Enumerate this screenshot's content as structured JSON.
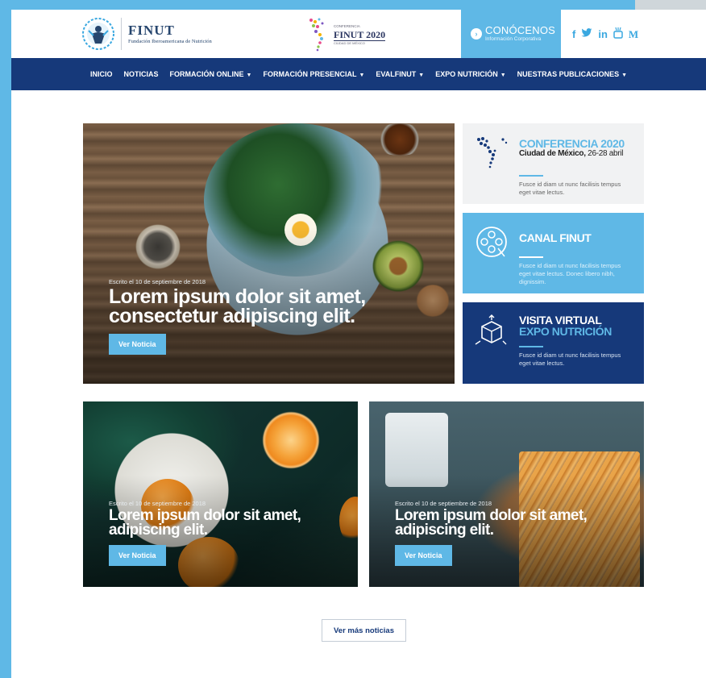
{
  "header": {
    "brand": "FINUT",
    "brand_subtitle": "Fundación Iberoamericana de Nutrición",
    "event_logo": {
      "line1": "CONFERENCIA",
      "name": "FINUT 2020",
      "line2": "CIUDAD DE MÉXICO"
    },
    "cta": {
      "title": "CONÓCENOS",
      "subtitle": "Información Corporativa"
    },
    "social": [
      {
        "icon": "facebook-icon",
        "glyph": "f"
      },
      {
        "icon": "twitter-icon",
        "glyph": "🐦"
      },
      {
        "icon": "linkedin-icon",
        "glyph": "in"
      },
      {
        "icon": "youtube-icon",
        "glyph": "▣"
      },
      {
        "icon": "medium-icon",
        "glyph": "M"
      }
    ]
  },
  "nav": {
    "items": [
      {
        "label": "INICIO",
        "dropdown": false
      },
      {
        "label": "NOTICIAS",
        "dropdown": false
      },
      {
        "label": "FORMACIÓN ONLINE",
        "dropdown": true
      },
      {
        "label": "FORMACIÓN PRESENCIAL",
        "dropdown": true
      },
      {
        "label": "EVALFINUT",
        "dropdown": true
      },
      {
        "label": "EXPO NUTRICIÓN",
        "dropdown": true
      },
      {
        "label": "NUESTRAS PUBLICACIONES",
        "dropdown": true
      }
    ]
  },
  "hero": {
    "meta": "Escrito el 10 de septiembre de 2018",
    "title_line1": "Lorem ipsum dolor sit amet,",
    "title_line2": "consectetur adipiscing elit.",
    "button": "Ver Noticia"
  },
  "panels": {
    "conferencia": {
      "title": "CONFERENCIA 2020",
      "place": "Ciudad de México,",
      "dates": " 26-28 abril",
      "desc": "Fusce id diam ut nunc facilisis tempus eget vitae lectus."
    },
    "canal": {
      "title": "CANAL FINUT",
      "desc": "Fusce id diam ut nunc facilisis tempus eget vitae lectus. Donec libero nibh, dignissim."
    },
    "visita": {
      "title_line1": "VISITA VIRTUAL",
      "title_line2": "EXPO NUTRICIÓN",
      "desc": "Fusce id diam ut nunc facilisis tempus eget vitae lectus."
    }
  },
  "news": [
    {
      "meta": "Escrito el 10 de septiembre de 2018",
      "title_line1": "Lorem ipsum dolor sit amet,",
      "title_line2": "adipiscing elit.",
      "button": "Ver Noticia"
    },
    {
      "meta": "Escrito el 10 de septiembre de 2018",
      "title_line1": "Lorem ipsum dolor sit amet,",
      "title_line2": "adipiscing elit.",
      "button": "Ver Noticia"
    }
  ],
  "more_button": "Ver más noticias",
  "colors": {
    "accent": "#5fb8e6",
    "navy": "#16397a"
  }
}
